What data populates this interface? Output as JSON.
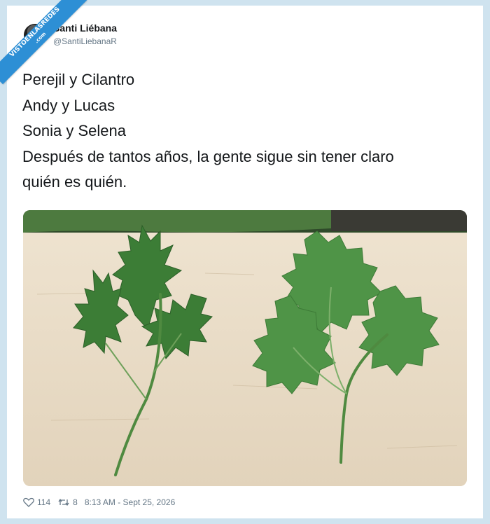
{
  "watermark": {
    "line1": "VISTOENLASREDES",
    "line2": ".com"
  },
  "author": {
    "name": "Santi Liébana",
    "handle": "@SantiLiebanaR"
  },
  "tweet": {
    "lines": [
      "Perejil y Cilantro",
      "Andy y Lucas",
      "Sonia y Selena",
      "Después de tantos años, la gente sigue sin tener claro",
      "quién es quién."
    ]
  },
  "footer": {
    "likes": "114",
    "retweets": "8",
    "timestamp": "8:13 AM - Sept 25, 2026"
  },
  "icons": {
    "like": "heart-icon",
    "retweet": "retweet-icon"
  },
  "colors": {
    "background": "#cfe3ef",
    "ribbon": "#2d8fd5",
    "muted": "#657786"
  }
}
